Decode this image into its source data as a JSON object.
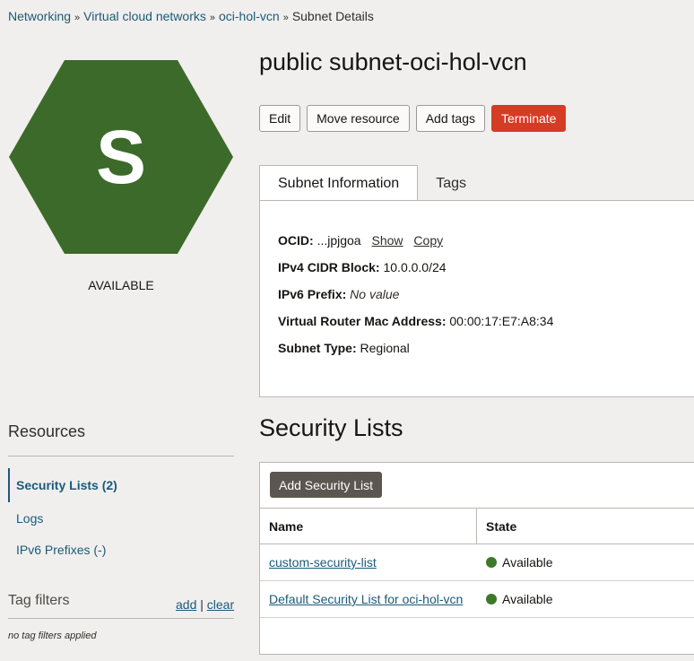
{
  "breadcrumb": {
    "items": [
      "Networking",
      "Virtual cloud networks",
      "oci-hol-vcn"
    ],
    "current": "Subnet Details",
    "separator": "»"
  },
  "resource_icon": {
    "letter": "S",
    "color": "#3c6a2a",
    "shape": "hexagon"
  },
  "status": "AVAILABLE",
  "page_title": "public subnet-oci-hol-vcn",
  "actions": {
    "edit": "Edit",
    "move": "Move resource",
    "add_tags": "Add tags",
    "terminate": "Terminate"
  },
  "tabs": {
    "info": "Subnet Information",
    "tags": "Tags"
  },
  "info": {
    "ocid_label": "OCID:",
    "ocid_value": "...jpjgoa",
    "ocid_show": "Show",
    "ocid_copy": "Copy",
    "ipv4_label": "IPv4 CIDR Block:",
    "ipv4_value": "10.0.0.0/24",
    "ipv6_label": "IPv6 Prefix:",
    "ipv6_value": "No value",
    "mac_label": "Virtual Router Mac Address:",
    "mac_value": "00:00:17:E7:A8:34",
    "type_label": "Subnet Type:",
    "type_value": "Regional"
  },
  "resources": {
    "title": "Resources",
    "items": [
      "Security Lists (2)",
      "Logs",
      "IPv6 Prefixes (-)"
    ]
  },
  "tag_filters": {
    "title": "Tag filters",
    "add": "add",
    "divider": "|",
    "clear": "clear",
    "empty": "no tag filters applied"
  },
  "security_lists": {
    "title": "Security Lists",
    "add_button": "Add Security List",
    "columns": [
      "Name",
      "State"
    ],
    "rows": [
      {
        "name": "custom-security-list",
        "state": "Available"
      },
      {
        "name": "Default Security List for oci-hol-vcn",
        "state": "Available"
      }
    ]
  },
  "colors": {
    "available": "#3c7a29",
    "terminate": "#d63b25",
    "link": "#1a5a7a"
  }
}
